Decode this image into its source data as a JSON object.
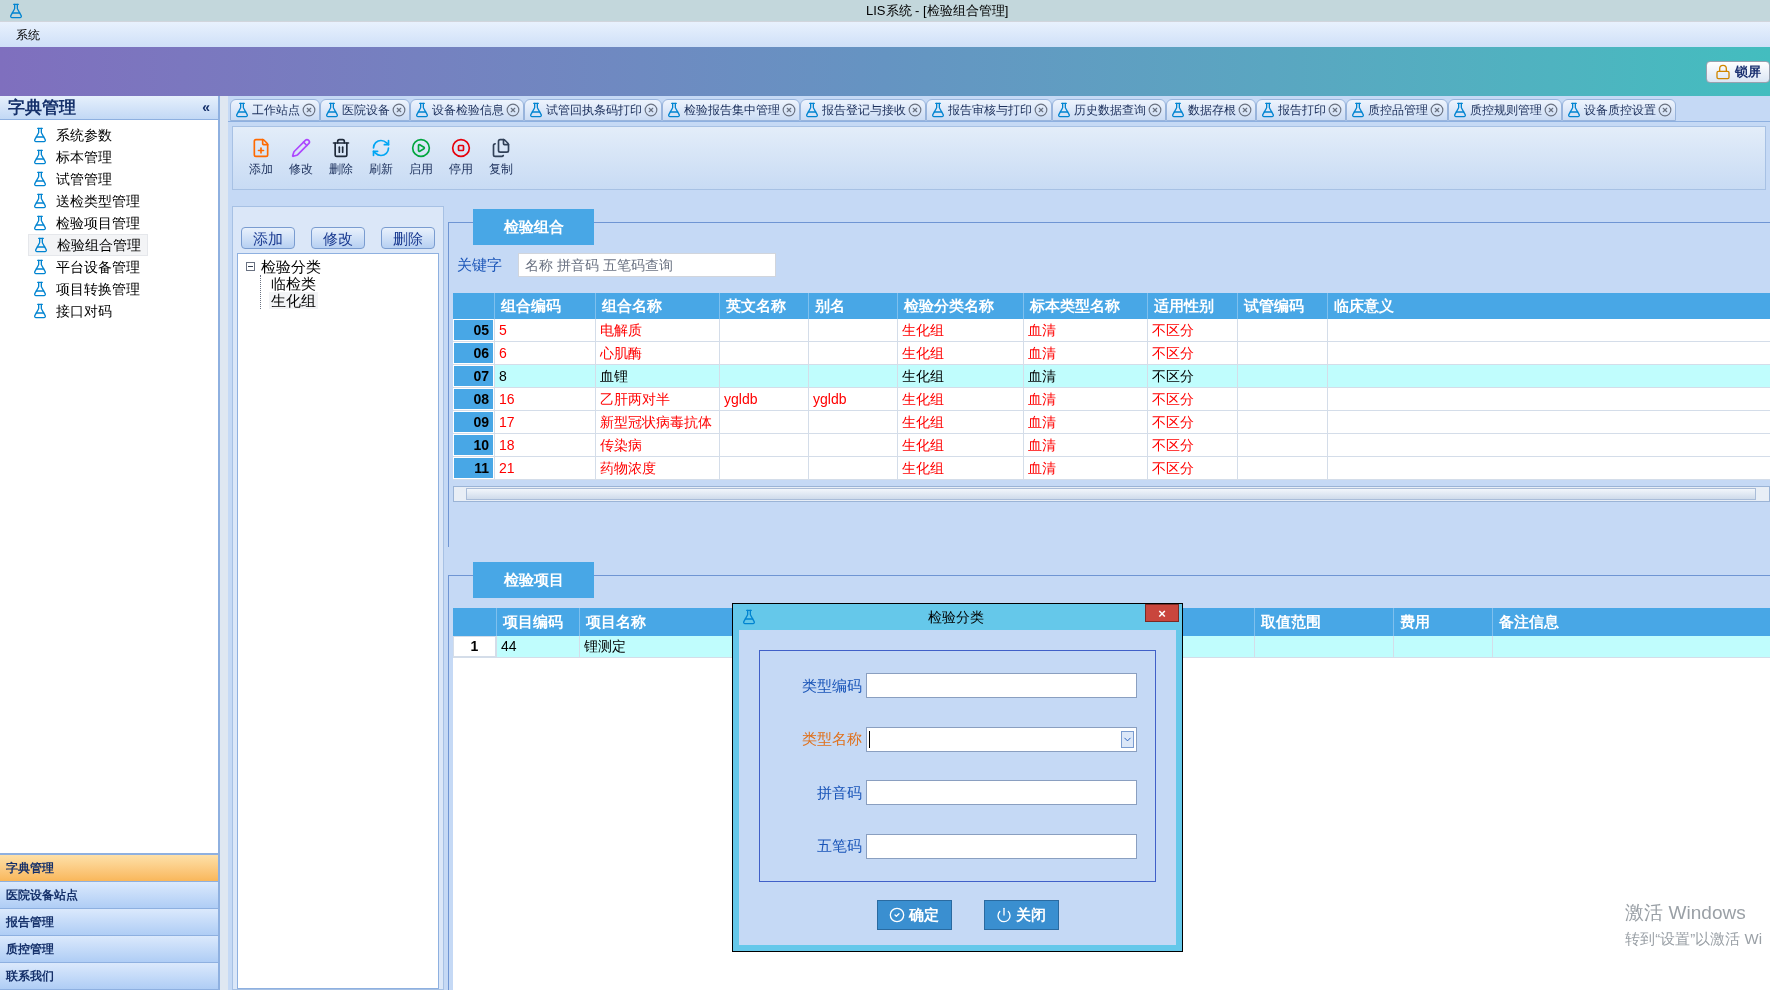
{
  "window": {
    "title": "LIS系统 - [检验组合管理]"
  },
  "menu": [
    "系统"
  ],
  "banner": {
    "lock_button": "锁屏"
  },
  "sidebar": {
    "title": "字典管理",
    "collapse": "«",
    "items": [
      {
        "label": "系统参数",
        "selected": false
      },
      {
        "label": "标本管理",
        "selected": false
      },
      {
        "label": "试管管理",
        "selected": false
      },
      {
        "label": "送检类型管理",
        "selected": false
      },
      {
        "label": "检验项目管理",
        "selected": false
      },
      {
        "label": "检验组合管理",
        "selected": true
      },
      {
        "label": "平台设备管理",
        "selected": false
      },
      {
        "label": "项目转换管理",
        "selected": false
      },
      {
        "label": "接口对码",
        "selected": false
      }
    ],
    "sections": [
      {
        "label": "字典管理",
        "selected": true
      },
      {
        "label": "医院设备站点",
        "selected": false
      },
      {
        "label": "报告管理",
        "selected": false
      },
      {
        "label": "质控管理",
        "selected": false
      },
      {
        "label": "联系我们",
        "selected": false
      }
    ]
  },
  "tabs": [
    "工作站点",
    "医院设备",
    "设备检验信息",
    "试管回执条码打印",
    "检验报告集中管理",
    "报告登记与接收",
    "报告审核与打印",
    "历史数据查询",
    "数据存根",
    "报告打印",
    "质控品管理",
    "质控规则管理",
    "设备质控设置"
  ],
  "toolbar": [
    {
      "label": "添加",
      "kind": "add"
    },
    {
      "label": "修改",
      "kind": "edit"
    },
    {
      "label": "删除",
      "kind": "delete"
    },
    {
      "label": "刷新",
      "kind": "refresh"
    },
    {
      "label": "启用",
      "kind": "enable"
    },
    {
      "label": "停用",
      "kind": "disable"
    },
    {
      "label": "复制",
      "kind": "copy"
    }
  ],
  "category_panel": {
    "buttons": [
      "添加",
      "修改",
      "删除"
    ],
    "tree": [
      {
        "label": "检验分类",
        "expanded": true,
        "selected": false,
        "children": [
          {
            "label": "临检类",
            "selected": false
          },
          {
            "label": "生化组",
            "selected": true
          }
        ]
      }
    ]
  },
  "combo_group": {
    "title": "检验组合",
    "search_label": "关键字",
    "search_placeholder": "名称 拼音码 五笔码查询",
    "columns": [
      "组合编码",
      "组合名称",
      "英文名称",
      "别名",
      "检验分类名称",
      "标本类型名称",
      "适用性别",
      "试管编码",
      "临床意义"
    ],
    "rows": [
      {
        "index": "05",
        "cells": [
          "5",
          "电解质",
          "",
          "",
          "生化组",
          "血清",
          "不区分",
          "",
          ""
        ],
        "color": "#ff0000",
        "selected": false
      },
      {
        "index": "06",
        "cells": [
          "6",
          "心肌酶",
          "",
          "",
          "生化组",
          "血清",
          "不区分",
          "",
          ""
        ],
        "color": "#ff0000",
        "selected": false
      },
      {
        "index": "07",
        "cells": [
          "8",
          "血锂",
          "",
          "",
          "生化组",
          "血清",
          "不区分",
          "",
          ""
        ],
        "color": "#000000",
        "selected": true
      },
      {
        "index": "08",
        "cells": [
          "16",
          "乙肝两对半",
          "ygldb",
          "ygldb",
          "生化组",
          "血清",
          "不区分",
          "",
          ""
        ],
        "color": "#ff0000",
        "selected": false
      },
      {
        "index": "09",
        "cells": [
          "17",
          "新型冠状病毒抗体",
          "",
          "",
          "生化组",
          "血清",
          "不区分",
          "",
          ""
        ],
        "color": "#ff0000",
        "selected": false
      },
      {
        "index": "10",
        "cells": [
          "18",
          "传染病",
          "",
          "",
          "生化组",
          "血清",
          "不区分",
          "",
          ""
        ],
        "color": "#ff0000",
        "selected": false
      },
      {
        "index": "11",
        "cells": [
          "21",
          "药物浓度",
          "",
          "",
          "生化组",
          "血清",
          "不区分",
          "",
          ""
        ],
        "color": "#ff0000",
        "selected": false
      }
    ]
  },
  "item_group": {
    "title": "检验项目",
    "columns": [
      "项目编码",
      "项目名称",
      "取值范围",
      "费用",
      "备注信息"
    ],
    "rows": [
      {
        "index": "1",
        "cells": [
          "44",
          "锂测定",
          "",
          "",
          ""
        ],
        "selected": true
      }
    ]
  },
  "dialog": {
    "title": "检验分类",
    "close": "×",
    "fields": [
      {
        "label": "类型编码",
        "kind": "text",
        "focused": false
      },
      {
        "label": "类型名称",
        "kind": "dropdown",
        "focused": true
      },
      {
        "label": "拼音码",
        "kind": "text",
        "focused": false
      },
      {
        "label": "五笔码",
        "kind": "text",
        "focused": false
      }
    ],
    "buttons": [
      {
        "label": "确定",
        "kind": "ok"
      },
      {
        "label": "关闭",
        "kind": "close"
      }
    ]
  },
  "os_notice": {
    "title": "激活 Windows",
    "hint": "转到“设置”以激活 Wi"
  }
}
